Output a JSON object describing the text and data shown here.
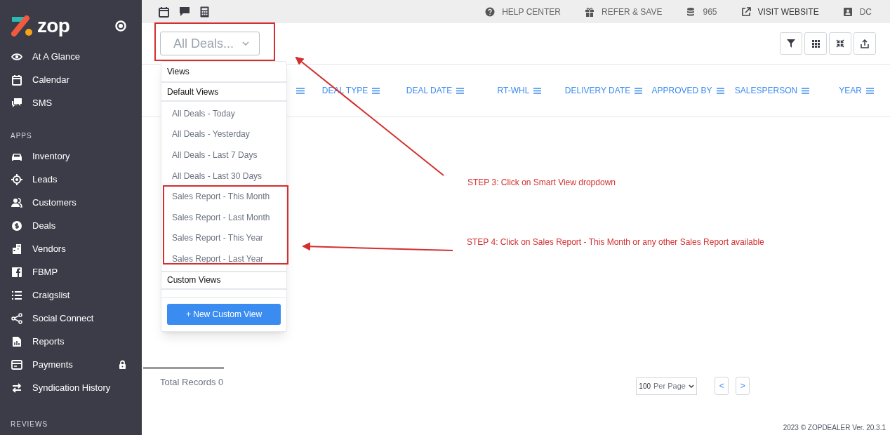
{
  "sidebar": {
    "logo": "zop",
    "top_items": [
      {
        "label": "At A Glance",
        "locked": false
      },
      {
        "label": "Calendar",
        "locked": false
      },
      {
        "label": "SMS",
        "locked": false
      }
    ],
    "apps_heading": "APPS",
    "app_items": [
      {
        "label": "Inventory",
        "locked": false
      },
      {
        "label": "Leads",
        "locked": false
      },
      {
        "label": "Customers",
        "locked": false
      },
      {
        "label": "Deals",
        "locked": false
      },
      {
        "label": "Vendors",
        "locked": false
      },
      {
        "label": "FBMP",
        "locked": false
      },
      {
        "label": "Craigslist",
        "locked": false
      },
      {
        "label": "Social Connect",
        "locked": false
      },
      {
        "label": "Reports",
        "locked": false
      },
      {
        "label": "Payments",
        "locked": true
      },
      {
        "label": "Syndication History",
        "locked": false
      }
    ],
    "reviews_heading": "REVIEWS"
  },
  "top_bar": {
    "links": [
      {
        "label": "HELP CENTER",
        "kind": "help"
      },
      {
        "label": "REFER & SAVE",
        "kind": "gift"
      },
      {
        "label": "965",
        "kind": "credits"
      },
      {
        "label": "VISIT WEBSITE",
        "kind": "external"
      },
      {
        "label": "DC",
        "kind": "user"
      }
    ]
  },
  "view_dropdown": {
    "value": "All Deals...",
    "expanded": true,
    "menu": {
      "title": "Views",
      "default_heading": "Default Views",
      "items": [
        "All Deals - Today",
        "All Deals - Yesterday",
        "All Deals - Last 7 Days",
        "All Deals - Last 30 Days",
        "Sales Report - This Month",
        "Sales Report - Last Month",
        "Sales Report - This Year",
        "Sales Report - Last Year"
      ],
      "custom_heading": "Custom Views",
      "new_button": "+ New Custom View"
    }
  },
  "table": {
    "columns": [
      "DEAL TYPE",
      "DEAL DATE",
      "RT-WHL",
      "DELIVERY DATE",
      "APPROVED BY",
      "SALESPERSON",
      "YEAR"
    ]
  },
  "footer": {
    "total_records": "Total Records 0",
    "per_page_value": "100",
    "per_page_label": "Per Page",
    "prev": "<",
    "next": ">",
    "copyright": "2023 © ZOPDEALER Ver. 20.3.1"
  },
  "annotations": [
    {
      "kind": "step",
      "text": "STEP 3: Click on Smart View dropdown"
    },
    {
      "kind": "step",
      "text": "STEP 4: Click on Sales Report - This Month or any other Sales Report available"
    }
  ]
}
